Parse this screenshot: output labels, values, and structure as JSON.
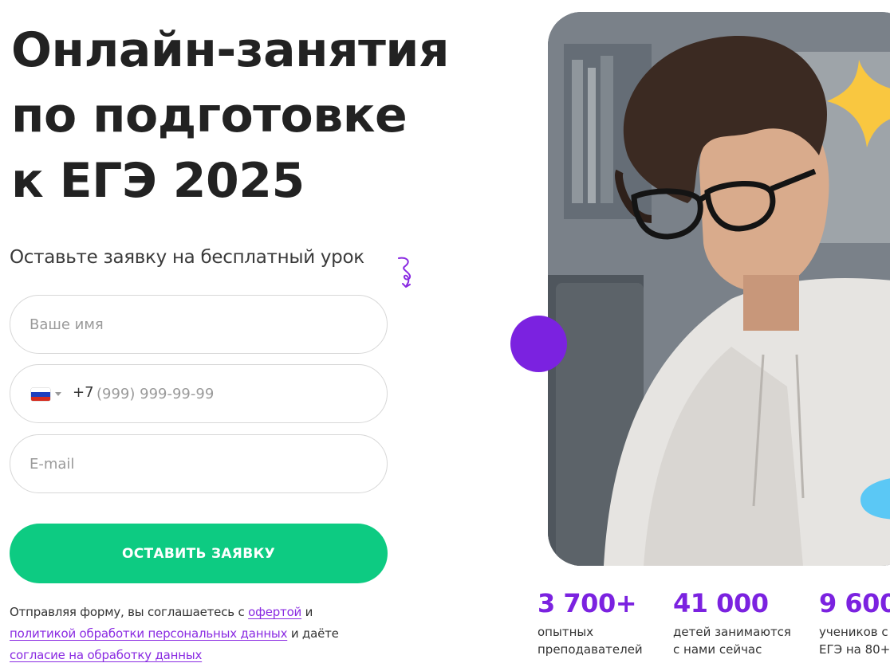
{
  "hero": {
    "title_lines": [
      "Онлайн-занятия",
      "по подготовке",
      "к ЕГЭ 2025"
    ],
    "subtitle": "Оставьте заявку на бесплатный урок"
  },
  "form": {
    "name_placeholder": "Ваше имя",
    "phone_code": "+7",
    "phone_placeholder": "(999) 999-99-99",
    "email_placeholder": "E-mail",
    "submit_label": "ОСТАВИТЬ ЗАЯВКУ",
    "country_flag": "russia-flag-icon"
  },
  "consent": {
    "text_1": "Отправляя форму, вы соглашаетесь с ",
    "link_offer": "офертой",
    "text_2": " и ",
    "link_policy": "политикой обработки персональных данных",
    "text_3": " и даёте ",
    "link_agreement": "согласие на обработку данных"
  },
  "stats": [
    {
      "value": "3 700+",
      "label_lines": [
        "опытных",
        "преподавателей"
      ]
    },
    {
      "value": "41 000",
      "label_lines": [
        "детей занимаются",
        "с нами сейчас"
      ]
    },
    {
      "value": "9 600",
      "label_lines": [
        "учеников с",
        "ЕГЭ на 80+"
      ]
    }
  ],
  "colors": {
    "accent_purple": "#7b22e0",
    "button_green": "#0dcb82",
    "link_purple": "#8a2be2",
    "decor_yellow": "#f9c740",
    "decor_blue": "#5bc8f5"
  }
}
